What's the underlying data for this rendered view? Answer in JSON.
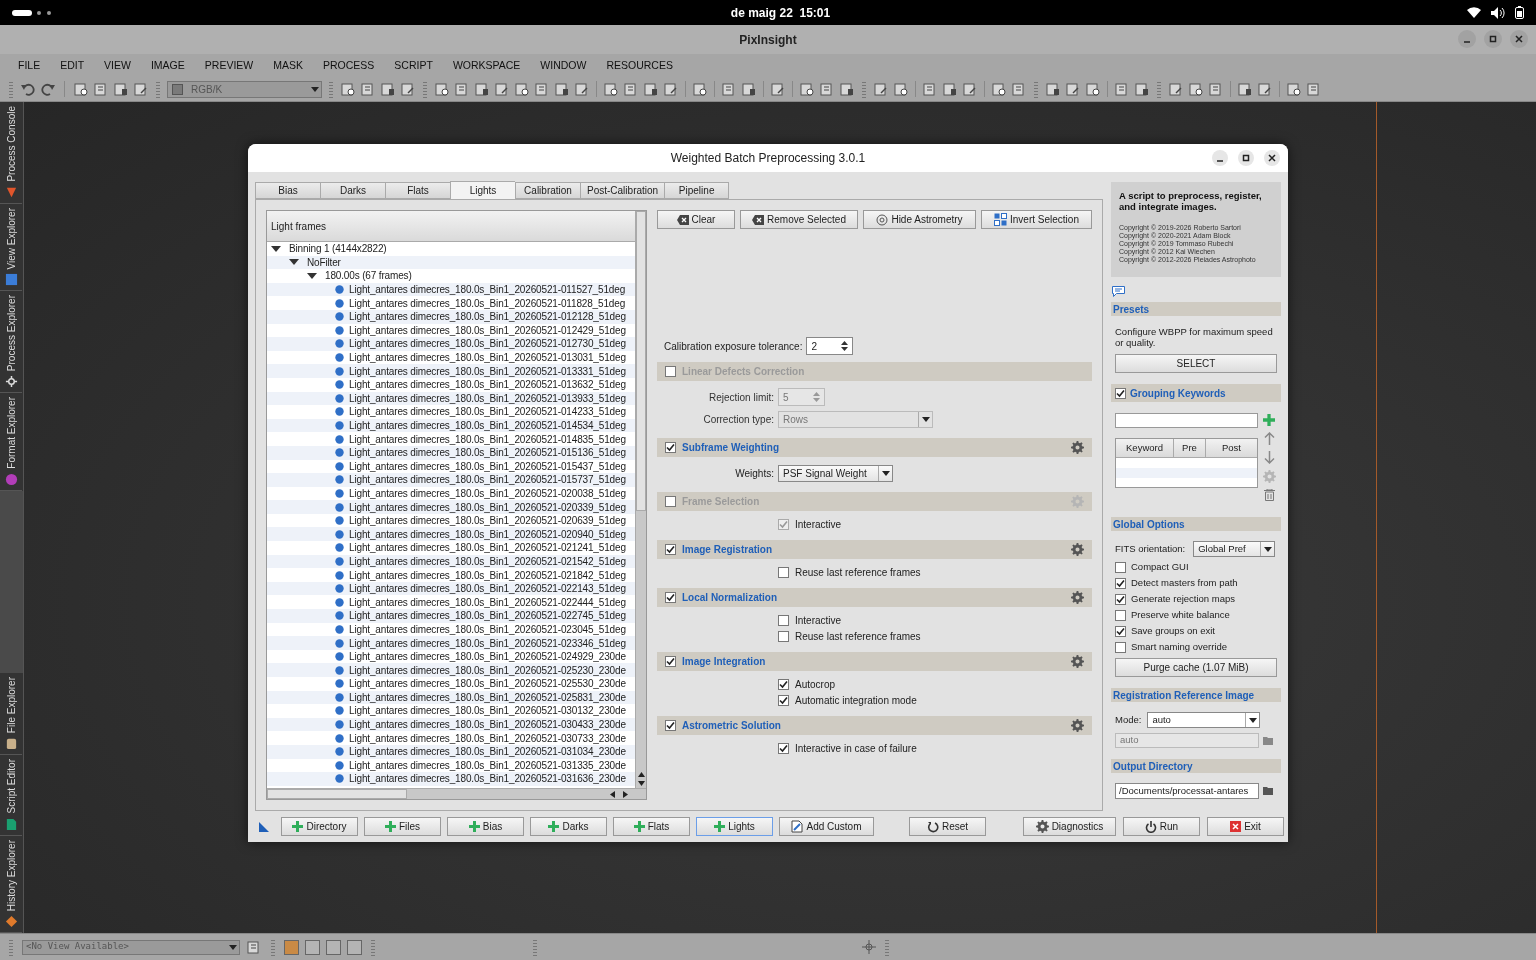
{
  "system_bar": {
    "clock": "de maig 22  15:01"
  },
  "app": {
    "title": "PixInsight"
  },
  "menu": [
    "FILE",
    "EDIT",
    "VIEW",
    "IMAGE",
    "PREVIEW",
    "MASK",
    "PROCESS",
    "SCRIPT",
    "WORKSPACE",
    "WINDOW",
    "RESOURCES"
  ],
  "toolbar": {
    "view_selector": "RGB/K"
  },
  "side_tabs_top": [
    {
      "label": "Process Console",
      "kind": "console"
    },
    {
      "label": "View Explorer",
      "kind": "view"
    },
    {
      "label": "Process Explorer",
      "kind": "process"
    },
    {
      "label": "Format Explorer",
      "kind": "format"
    }
  ],
  "side_tabs_bottom": [
    {
      "label": "File Explorer",
      "kind": "file"
    },
    {
      "label": "Script Editor",
      "kind": "script"
    },
    {
      "label": "History Explorer",
      "kind": "history"
    }
  ],
  "dialog": {
    "title": "Weighted Batch Preprocessing 3.0.1",
    "tabs": [
      {
        "label": "Bias",
        "selected": false
      },
      {
        "label": "Darks",
        "selected": false
      },
      {
        "label": "Flats",
        "selected": false
      },
      {
        "label": "Lights",
        "selected": true
      },
      {
        "label": "Calibration",
        "selected": false
      },
      {
        "label": "Post-Calibration",
        "selected": false
      },
      {
        "label": "Pipeline",
        "selected": false
      }
    ],
    "frames": {
      "header": "Light frames",
      "tree": [
        {
          "label": "Binning 1 (4144x2822)",
          "expanded": true,
          "children": [
            {
              "label": "NoFilter",
              "expanded": true,
              "children": [
                {
                  "label": "180.00s (67 frames)",
                  "expanded": true,
                  "children": [
                    {
                      "label": "Light_antares dimecres_180.0s_Bin1_20260521-011527_51deg"
                    },
                    {
                      "label": "Light_antares dimecres_180.0s_Bin1_20260521-011828_51deg"
                    },
                    {
                      "label": "Light_antares dimecres_180.0s_Bin1_20260521-012128_51deg"
                    },
                    {
                      "label": "Light_antares dimecres_180.0s_Bin1_20260521-012429_51deg"
                    },
                    {
                      "label": "Light_antares dimecres_180.0s_Bin1_20260521-012730_51deg"
                    },
                    {
                      "label": "Light_antares dimecres_180.0s_Bin1_20260521-013031_51deg"
                    },
                    {
                      "label": "Light_antares dimecres_180.0s_Bin1_20260521-013331_51deg"
                    },
                    {
                      "label": "Light_antares dimecres_180.0s_Bin1_20260521-013632_51deg"
                    },
                    {
                      "label": "Light_antares dimecres_180.0s_Bin1_20260521-013933_51deg"
                    },
                    {
                      "label": "Light_antares dimecres_180.0s_Bin1_20260521-014233_51deg"
                    },
                    {
                      "label": "Light_antares dimecres_180.0s_Bin1_20260521-014534_51deg"
                    },
                    {
                      "label": "Light_antares dimecres_180.0s_Bin1_20260521-014835_51deg"
                    },
                    {
                      "label": "Light_antares dimecres_180.0s_Bin1_20260521-015136_51deg"
                    },
                    {
                      "label": "Light_antares dimecres_180.0s_Bin1_20260521-015437_51deg"
                    },
                    {
                      "label": "Light_antares dimecres_180.0s_Bin1_20260521-015737_51deg"
                    },
                    {
                      "label": "Light_antares dimecres_180.0s_Bin1_20260521-020038_51deg"
                    },
                    {
                      "label": "Light_antares dimecres_180.0s_Bin1_20260521-020339_51deg"
                    },
                    {
                      "label": "Light_antares dimecres_180.0s_Bin1_20260521-020639_51deg"
                    },
                    {
                      "label": "Light_antares dimecres_180.0s_Bin1_20260521-020940_51deg"
                    },
                    {
                      "label": "Light_antares dimecres_180.0s_Bin1_20260521-021241_51deg"
                    },
                    {
                      "label": "Light_antares dimecres_180.0s_Bin1_20260521-021542_51deg"
                    },
                    {
                      "label": "Light_antares dimecres_180.0s_Bin1_20260521-021842_51deg"
                    },
                    {
                      "label": "Light_antares dimecres_180.0s_Bin1_20260521-022143_51deg"
                    },
                    {
                      "label": "Light_antares dimecres_180.0s_Bin1_20260521-022444_51deg"
                    },
                    {
                      "label": "Light_antares dimecres_180.0s_Bin1_20260521-022745_51deg"
                    },
                    {
                      "label": "Light_antares dimecres_180.0s_Bin1_20260521-023045_51deg"
                    },
                    {
                      "label": "Light_antares dimecres_180.0s_Bin1_20260521-023346_51deg"
                    },
                    {
                      "label": "Light_antares dimecres_180.0s_Bin1_20260521-024929_230de"
                    },
                    {
                      "label": "Light_antares dimecres_180.0s_Bin1_20260521-025230_230de"
                    },
                    {
                      "label": "Light_antares dimecres_180.0s_Bin1_20260521-025530_230de"
                    },
                    {
                      "label": "Light_antares dimecres_180.0s_Bin1_20260521-025831_230de"
                    },
                    {
                      "label": "Light_antares dimecres_180.0s_Bin1_20260521-030132_230de"
                    },
                    {
                      "label": "Light_antares dimecres_180.0s_Bin1_20260521-030433_230de"
                    },
                    {
                      "label": "Light_antares dimecres_180.0s_Bin1_20260521-030733_230de"
                    },
                    {
                      "label": "Light_antares dimecres_180.0s_Bin1_20260521-031034_230de"
                    },
                    {
                      "label": "Light_antares dimecres_180.0s_Bin1_20260521-031335_230de"
                    },
                    {
                      "label": "Light_antares dimecres_180.0s_Bin1_20260521-031636_230de"
                    }
                  ]
                }
              ]
            }
          ]
        }
      ]
    },
    "actions": [
      {
        "label": "Clear",
        "kind": "clear"
      },
      {
        "label": "Remove Selected",
        "kind": "clear"
      },
      {
        "label": "Hide Astrometry",
        "kind": "astrometry"
      },
      {
        "label": "Invert Selection",
        "kind": "invert"
      }
    ],
    "tolerance": {
      "label": "Calibration exposure tolerance:",
      "value": "2"
    },
    "sections": [
      {
        "title": "Linear Defects Correction",
        "checked": false,
        "gear": false,
        "options": [
          {
            "kind": "spin",
            "label": "Rejection limit:",
            "value": "5",
            "disabled": true
          },
          {
            "kind": "select",
            "label": "Correction type:",
            "value": "Rows",
            "disabled": true
          }
        ]
      },
      {
        "title": "Subframe Weighting",
        "checked": true,
        "gear": true,
        "options": [
          {
            "kind": "select",
            "label": "Weights:",
            "value": "PSF Signal Weight",
            "disabled": false
          }
        ]
      },
      {
        "title": "Frame Selection",
        "checked": false,
        "gear": true,
        "options": [
          {
            "kind": "check",
            "label": "Interactive",
            "checked": true,
            "disabled": true
          }
        ]
      },
      {
        "title": "Image Registration",
        "checked": true,
        "gear": true,
        "options": [
          {
            "kind": "check",
            "label": "Reuse last reference frames",
            "checked": false,
            "disabled": false
          }
        ]
      },
      {
        "title": "Local Normalization",
        "checked": true,
        "gear": true,
        "options": [
          {
            "kind": "check",
            "label": "Interactive",
            "checked": false,
            "disabled": false
          },
          {
            "kind": "check",
            "label": "Reuse last reference frames",
            "checked": false,
            "disabled": false
          }
        ]
      },
      {
        "title": "Image Integration",
        "checked": true,
        "gear": true,
        "options": [
          {
            "kind": "check",
            "label": "Autocrop",
            "checked": true,
            "disabled": false
          },
          {
            "kind": "check",
            "label": "Automatic integration mode",
            "checked": true,
            "disabled": false
          }
        ]
      },
      {
        "title": "Astrometric Solution",
        "checked": true,
        "gear": true,
        "options": [
          {
            "kind": "check",
            "label": "Interactive in case of failure",
            "checked": true,
            "disabled": false
          }
        ]
      }
    ],
    "about": {
      "heading": "A script to preprocess, register, and integrate images.",
      "copyrights": [
        "Copyright © 2019-2026 Roberto Sartori",
        "Copyright © 2020-2021 Adam Block",
        "Copyright © 2019 Tommaso Rubechi",
        "Copyright © 2012 Kai Wiechen",
        "Copyright © 2012-2026 Pleiades Astrophoto"
      ]
    },
    "presets": {
      "title": "Presets",
      "text": "Configure WBPP for maximum speed or quality.",
      "button": "SELECT"
    },
    "grouping": {
      "title": "Grouping Keywords",
      "checked": true,
      "columns": [
        "Keyword",
        "Pre",
        "Post"
      ]
    },
    "global_options": {
      "title": "Global Options",
      "fits_label": "FITS orientation:",
      "fits_value": "Global Pref",
      "checks": [
        {
          "label": "Compact GUI",
          "checked": false
        },
        {
          "label": "Detect masters from path",
          "checked": true
        },
        {
          "label": "Generate rejection maps",
          "checked": true
        },
        {
          "label": "Preserve white balance",
          "checked": false
        },
        {
          "label": "Save groups on exit",
          "checked": true
        },
        {
          "label": "Smart naming override",
          "checked": false
        }
      ],
      "purge": "Purge cache (1.07 MiB)"
    },
    "reference": {
      "title": "Registration Reference Image",
      "mode_label": "Mode:",
      "mode": "auto",
      "path": "auto"
    },
    "output": {
      "title": "Output Directory",
      "path": "/Documents/processat-antares"
    },
    "bottom_buttons": [
      {
        "label": "Directory",
        "kind": "add",
        "selected": false
      },
      {
        "label": "Files",
        "kind": "add",
        "selected": false
      },
      {
        "label": "Bias",
        "kind": "add",
        "selected": false
      },
      {
        "label": "Darks",
        "kind": "add",
        "selected": false
      },
      {
        "label": "Flats",
        "kind": "add",
        "selected": false
      },
      {
        "label": "Lights",
        "kind": "add",
        "selected": true
      },
      {
        "label": "Add Custom",
        "kind": "custom",
        "selected": false
      },
      {
        "label": "Reset",
        "kind": "reset",
        "selected": false
      },
      {
        "label": "Diagnostics",
        "kind": "diagnostics",
        "selected": false
      },
      {
        "label": "Run",
        "kind": "run",
        "selected": false
      },
      {
        "label": "Exit",
        "kind": "exit",
        "selected": false
      }
    ]
  },
  "status_bar": {
    "view": "<No View Available>"
  }
}
